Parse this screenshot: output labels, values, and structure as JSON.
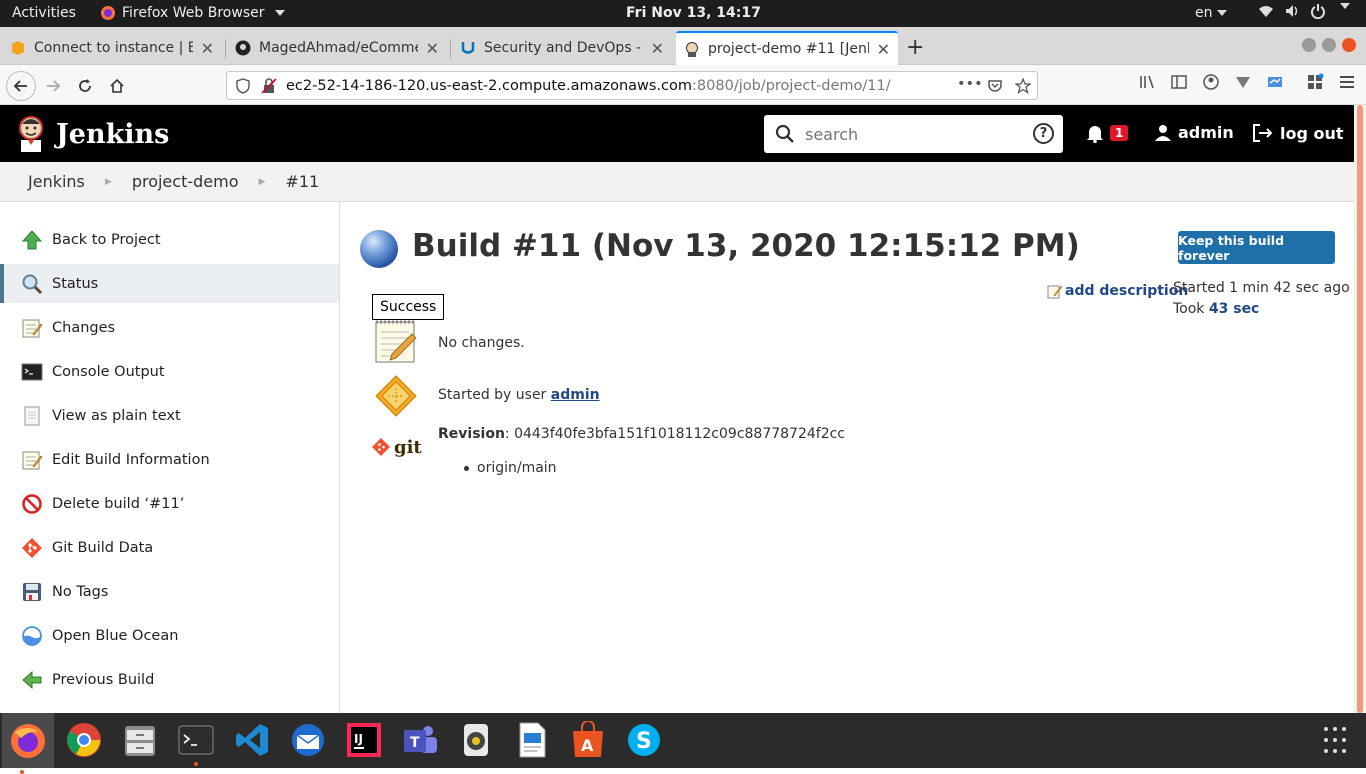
{
  "system_bar": {
    "activities": "Activities",
    "app_name": "Firefox Web Browser",
    "clock": "Fri Nov 13, 14:17",
    "language": "en"
  },
  "browser": {
    "tabs": [
      {
        "title": "Connect to instance | EC2",
        "icon": "aws-icon"
      },
      {
        "title": "MagedAhmad/eCommerce",
        "icon": "github-icon"
      },
      {
        "title": "Security and DevOps - Udacity",
        "icon": "udacity-icon"
      },
      {
        "title": "project-demo #11 [Jenkins]",
        "icon": "jenkins-icon",
        "active": true
      }
    ],
    "url_host": "ec2-52-14-186-120.us-east-2.compute.amazonaws.com",
    "url_path": ":8080/job/project-demo/11/",
    "url_more": "•••"
  },
  "jenkins": {
    "brand": "Jenkins",
    "search_placeholder": "search",
    "help": "?",
    "notification_count": "1",
    "user": "admin",
    "logout": "log out"
  },
  "breadcrumb": [
    "Jenkins",
    "project-demo",
    "#11"
  ],
  "side_tasks": [
    {
      "label": "Back to Project",
      "icon": "up-arrow-icon"
    },
    {
      "label": "Status",
      "icon": "magnifier-icon",
      "selected": true
    },
    {
      "label": "Changes",
      "icon": "notepad-icon"
    },
    {
      "label": "Console Output",
      "icon": "terminal-icon"
    },
    {
      "label": "View as plain text",
      "icon": "document-icon"
    },
    {
      "label": "Edit Build Information",
      "icon": "notepad-icon"
    },
    {
      "label": "Delete build ‘#11’",
      "icon": "no-entry-icon"
    },
    {
      "label": "Git Build Data",
      "icon": "git-icon"
    },
    {
      "label": "No Tags",
      "icon": "save-icon"
    },
    {
      "label": "Open Blue Ocean",
      "icon": "blue-ocean-icon"
    },
    {
      "label": "Previous Build",
      "icon": "left-arrow-icon"
    }
  ],
  "build": {
    "title": "Build #11 (Nov 13, 2020 12:15:12 PM)",
    "keep_button": "Keep this build forever",
    "add_description": "add description",
    "started": "Started 1 min 42 sec ago",
    "took_label": "Took",
    "took_value": "43 sec",
    "status_tooltip": "Success",
    "changes": "No changes.",
    "started_by_prefix": "Started by user",
    "started_by_user": "admin",
    "revision_label": "Revision",
    "revision_value": ": 0443f40fe3bfa151f1018112c09c88778724f2cc",
    "branch": "origin/main"
  },
  "colors": {
    "jenkins_header": "#000000",
    "keep_button": "#1f6fa9",
    "link": "#204a87",
    "notification_badge": "#e0162b"
  }
}
